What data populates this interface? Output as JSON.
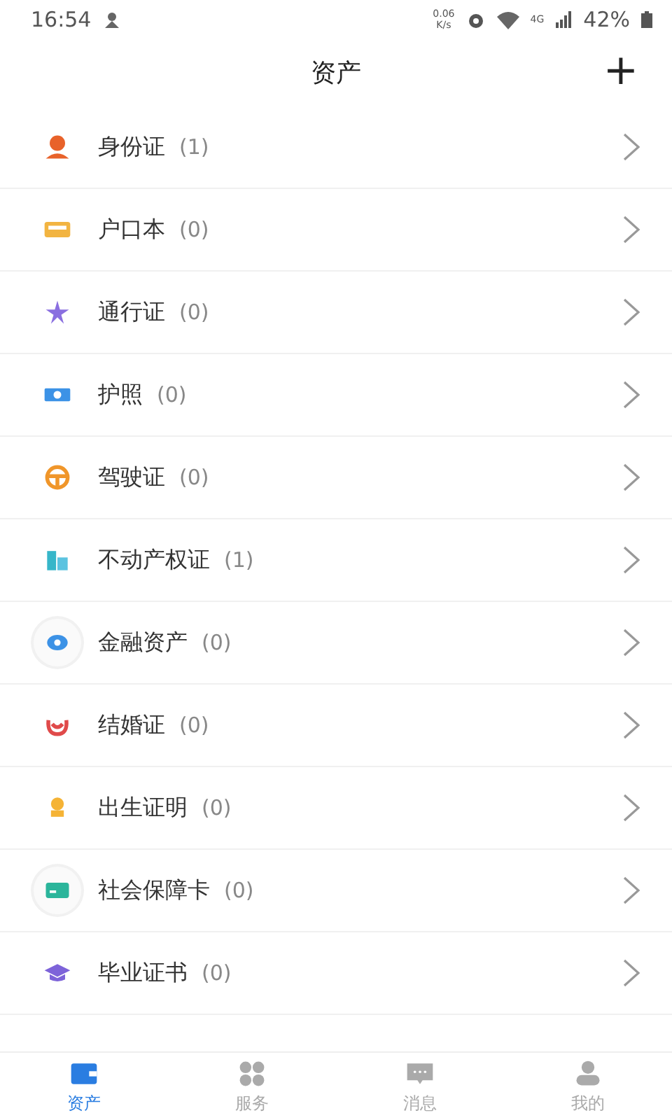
{
  "status_bar": {
    "time": "16:54",
    "speed": "0.06",
    "speed_unit": "K/s",
    "network": "4G",
    "battery": "42%"
  },
  "header": {
    "title": "资产",
    "add": "+"
  },
  "items": [
    {
      "name": "身份证",
      "count": "(1)"
    },
    {
      "name": "户口本",
      "count": "(0)"
    },
    {
      "name": "通行证",
      "count": "(0)"
    },
    {
      "name": "护照",
      "count": "(0)"
    },
    {
      "name": "驾驶证",
      "count": "(0)"
    },
    {
      "name": "不动产权证",
      "count": "(1)"
    },
    {
      "name": "金融资产",
      "count": "(0)"
    },
    {
      "name": "结婚证",
      "count": "(0)"
    },
    {
      "name": "出生证明",
      "count": "(0)"
    },
    {
      "name": "社会保障卡",
      "count": "(0)"
    },
    {
      "name": "毕业证书",
      "count": "(0)"
    }
  ],
  "tabs": [
    {
      "label": "资产",
      "selected": true
    },
    {
      "label": "服务",
      "selected": false
    },
    {
      "label": "消息",
      "selected": false
    },
    {
      "label": "我的",
      "selected": false
    }
  ]
}
